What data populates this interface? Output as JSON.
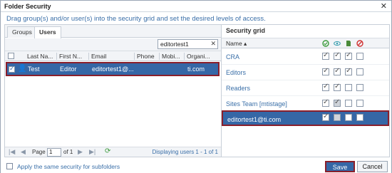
{
  "dialog": {
    "title": "Folder Security",
    "close_icon": "close-icon",
    "instructions": "Drag group(s) and/or user(s) into the security grid and set the desired levels of access."
  },
  "left": {
    "tabs": [
      {
        "label": "Groups",
        "active": false
      },
      {
        "label": "Users",
        "active": true
      }
    ],
    "search": {
      "value": "editortest1",
      "clear_glyph": "✕"
    },
    "columns": [
      "Last Na...",
      "First N...",
      "Email",
      "Phone",
      "Mobi...",
      "Organi..."
    ],
    "rows": [
      {
        "last": "Test",
        "first": "Editor",
        "email": "editortest1@...",
        "phone": "",
        "mobile": "",
        "org": "ti.com",
        "checked": true,
        "selected": true
      }
    ],
    "pager": {
      "page_label": "Page",
      "page_value": "1",
      "of_label": "of 1",
      "display": "Displaying users 1 - 1 of 1",
      "first_glyph": "|◀",
      "prev_glyph": "◀",
      "next_glyph": "▶",
      "last_glyph": "▶|",
      "refresh_glyph": "⟳"
    }
  },
  "right": {
    "title": "Security grid",
    "name_header": "Name ▴",
    "perm_icons": [
      {
        "name": "approve-icon",
        "color": "#3a9a3a"
      },
      {
        "name": "view-icon",
        "color": "#3aa0b0"
      },
      {
        "name": "edit-icon",
        "color": "#4a8a3a"
      },
      {
        "name": "deny-icon",
        "color": "#d03030"
      }
    ],
    "rows": [
      {
        "name": "CRA",
        "perms": [
          true,
          true,
          true,
          false
        ],
        "selected": false
      },
      {
        "name": "Editors",
        "perms": [
          true,
          true,
          true,
          false
        ],
        "selected": false
      },
      {
        "name": "Readers",
        "perms": [
          true,
          true,
          false,
          false
        ],
        "selected": false
      },
      {
        "name": "Sites Team [mtistage]",
        "perms": [
          true,
          true,
          false,
          false
        ],
        "selected": false
      },
      {
        "name": "editortest1@ti.com",
        "perms": [
          true,
          false,
          false,
          false
        ],
        "selected": true
      }
    ]
  },
  "footer": {
    "apply_label": "Apply the same security for subfolders",
    "save_label": "Save",
    "cancel_label": "Cancel"
  },
  "colors": {
    "accent": "#3567a6",
    "highlight_border": "#8a1f2b",
    "link_text": "#3a6fa8"
  }
}
